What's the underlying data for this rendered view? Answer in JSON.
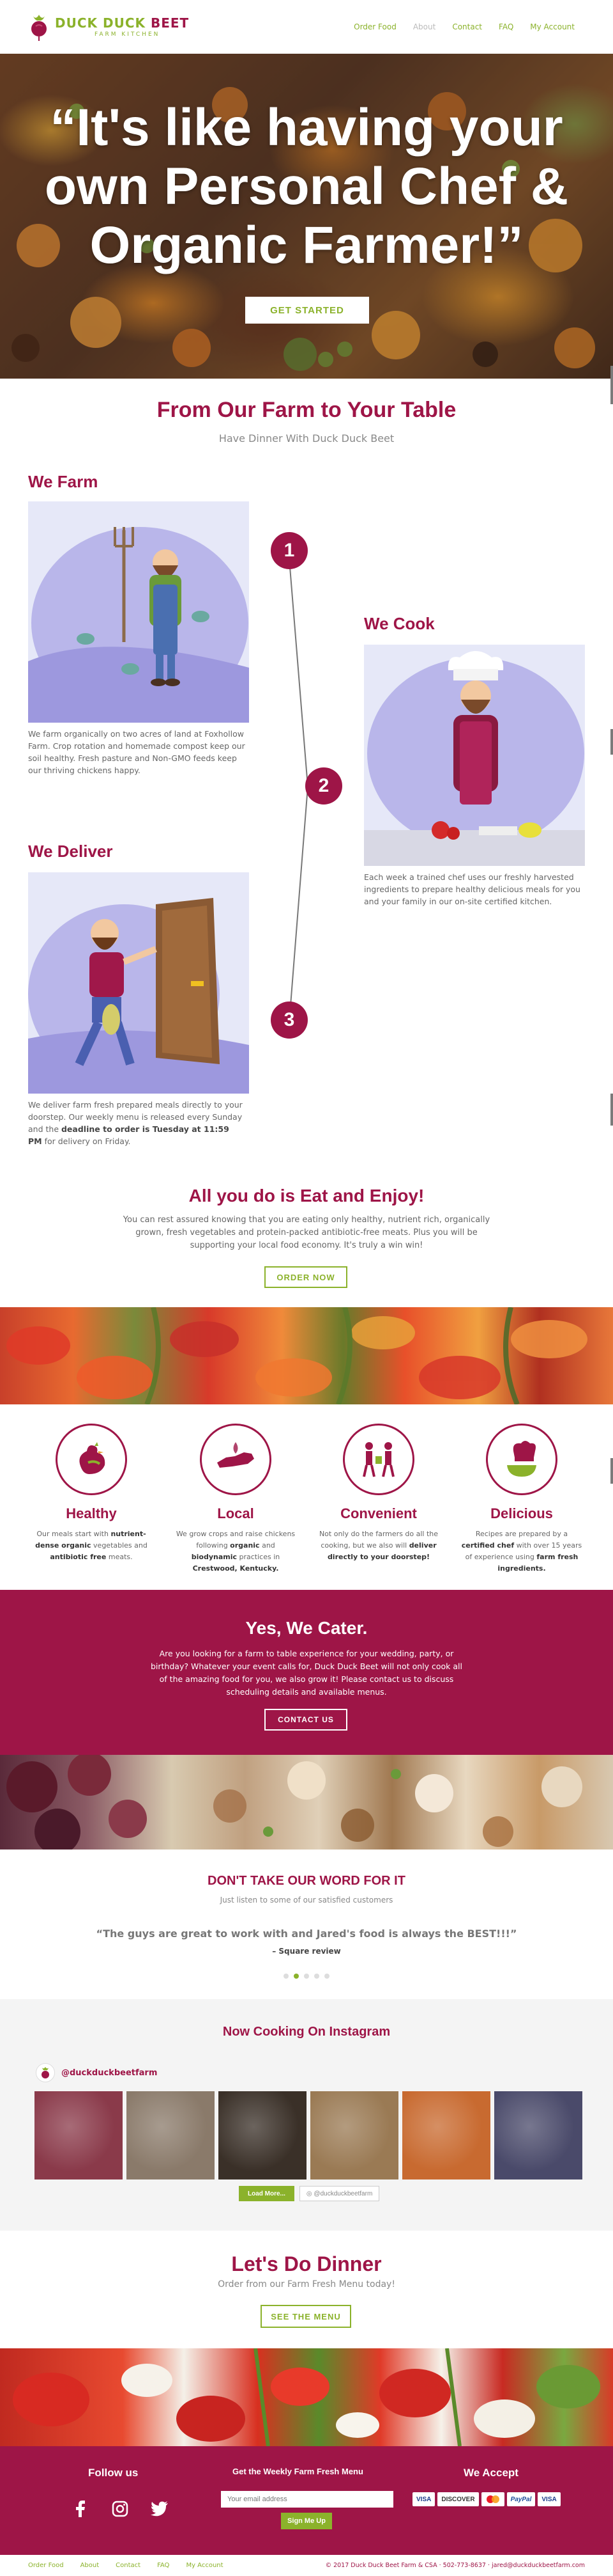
{
  "brand": {
    "name_part1": "DUCK DUCK",
    "name_part2": "BEET",
    "tagline": "FARM KITCHEN",
    "primary_color": "#9e1547",
    "accent_color": "#8bb22b"
  },
  "nav": {
    "items": [
      {
        "label": "Order Food"
      },
      {
        "label": "About"
      },
      {
        "label": "Contact"
      },
      {
        "label": "FAQ"
      },
      {
        "label": "My Account"
      }
    ],
    "active": "About"
  },
  "hero": {
    "title": "“It's like having your own Personal Chef & Organic Farmer!”",
    "button": "GET STARTED"
  },
  "farm_to_table": {
    "title": "From Our Farm to Your Table",
    "subtitle": "Have Dinner With Duck Duck Beet",
    "steps": [
      {
        "number": "1",
        "heading": "We Farm",
        "text": "We farm organically on two acres of land at Foxhollow Farm. Crop rotation and homemade compost keep our soil healthy. Fresh pasture and Non-GMO feeds keep our thriving chickens happy."
      },
      {
        "number": "2",
        "heading": "We Cook",
        "text": "Each week a trained chef uses our freshly harvested ingredients to prepare healthy delicious meals for you and your family in our on-site certified kitchen."
      },
      {
        "number": "3",
        "heading": "We Deliver",
        "text_a": "We deliver farm fresh prepared meals directly to your doorstep. Our weekly menu is released every Sunday and the ",
        "text_bold": "deadline to order is Tuesday at 11:59 PM",
        "text_b": " for delivery on Friday."
      }
    ]
  },
  "enjoy": {
    "title": "All you do is Eat and Enjoy!",
    "text": "You can rest assured knowing that you are eating only healthy, nutrient rich, organically grown, fresh vegetables and protein-packed antibiotic-free meats. Plus you will be supporting your local food economy. It's truly a win win!",
    "button": "ORDER NOW"
  },
  "features": [
    {
      "title": "Healthy",
      "icon": "chicken-icon",
      "parts": [
        {
          "t": "Our meals start with ",
          "b": false
        },
        {
          "t": "nutrient-dense organic",
          "b": true
        },
        {
          "t": " vegetables and ",
          "b": false
        },
        {
          "t": "antibiotic free",
          "b": true
        },
        {
          "t": " meats.",
          "b": false
        }
      ]
    },
    {
      "title": "Local",
      "icon": "kentucky-icon",
      "parts": [
        {
          "t": "We grow crops and raise chickens following ",
          "b": false
        },
        {
          "t": "organic",
          "b": true
        },
        {
          "t": " and ",
          "b": false
        },
        {
          "t": "biodynamic",
          "b": true
        },
        {
          "t": " practices in ",
          "b": false
        },
        {
          "t": "Crestwood, Kentucky.",
          "b": true
        }
      ]
    },
    {
      "title": "Convenient",
      "icon": "handoff-icon",
      "parts": [
        {
          "t": "Not only do the farmers do all the cooking, but we also will ",
          "b": false
        },
        {
          "t": "deliver directly to your doorstep!",
          "b": true
        }
      ]
    },
    {
      "title": "Delicious",
      "icon": "chef-hat-icon",
      "parts": [
        {
          "t": "Recipes are prepared by a ",
          "b": false
        },
        {
          "t": "certified chef",
          "b": true
        },
        {
          "t": " with over 15 years of experience using ",
          "b": false
        },
        {
          "t": "farm fresh ingredients.",
          "b": true
        }
      ]
    }
  ],
  "cater": {
    "title": "Yes, We Cater.",
    "text": "Are you looking for a farm to table experience for your wedding, party, or birthday? Whatever your event calls for, Duck Duck Beet will not only cook all of the amazing food for you, we also grow it! Please contact us to discuss scheduling details and available menus.",
    "button": "CONTACT US"
  },
  "testimonial": {
    "title": "DON'T TAKE OUR WORD FOR IT",
    "subtitle": "Just listen to some of our satisfied customers",
    "quote": "“The guys are great to work with and Jared's food is always the BEST!!!”",
    "author": "– Square review",
    "dot_count": 5,
    "active_dot": 1
  },
  "instagram": {
    "title": "Now Cooking On Instagram",
    "username": "@duckduckbeetfarm",
    "load_more": "Load More...",
    "follow": "@duckduckbeetfarm",
    "tiles": [
      "#8a3a4a",
      "#8a7a6a",
      "#3a3028",
      "#9a7a54",
      "#c86a30",
      "#4a4a6a"
    ]
  },
  "dinner": {
    "title": "Let's Do Dinner",
    "subtitle": "Order from our Farm Fresh Menu today!",
    "button": "SEE THE MENU"
  },
  "footer": {
    "follow_title": "Follow us",
    "social": [
      "facebook-icon",
      "instagram-icon",
      "twitter-icon"
    ],
    "newsletter_title": "Get the Weekly Farm Fresh Menu",
    "email_placeholder": "Your email address",
    "signup_button": "Sign Me Up",
    "accept_title": "We Accept",
    "cards": [
      "VISA",
      "DISCOVER",
      "MC",
      "PayPal",
      "VISA"
    ]
  },
  "bottom": {
    "nav": [
      "Order Food",
      "About",
      "Contact",
      "FAQ",
      "My Account"
    ],
    "copyright": "© 2017 Duck Duck Beet Farm & CSA · 502-773-8637 · jared@duckduckbeetfarm.com"
  }
}
